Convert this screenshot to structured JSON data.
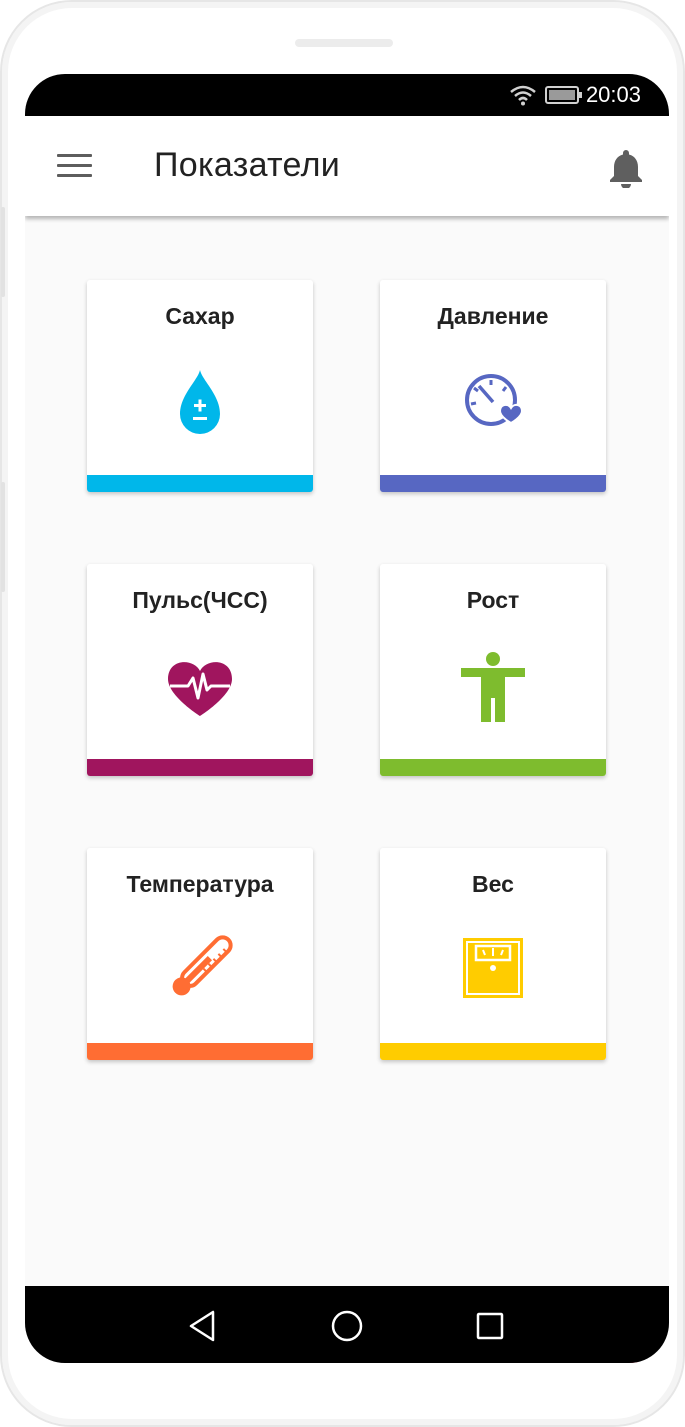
{
  "status_bar": {
    "time": "20:03"
  },
  "app_bar": {
    "title": "Показатели"
  },
  "colors": {
    "sugar": "#00b7ea",
    "pressure": "#5767c2",
    "pulse": "#a0155e",
    "height": "#7ebc2e",
    "temperature": "#ff6d33",
    "weight": "#ffcc00",
    "fab": "#ff3358"
  },
  "cards": [
    {
      "title": "Сахар",
      "icon": "drop-icon",
      "color": "#00b7ea"
    },
    {
      "title": "Давление",
      "icon": "pressure-gauge-heart-icon",
      "color": "#5767c2"
    },
    {
      "title": "Пульс(ЧСС)",
      "icon": "heart-pulse-icon",
      "color": "#a0155e"
    },
    {
      "title": "Рост",
      "icon": "person-icon",
      "color": "#7ebc2e"
    },
    {
      "title": "Температура",
      "icon": "thermometer-icon",
      "color": "#ff6d33"
    },
    {
      "title": "Вес",
      "icon": "scale-icon",
      "color": "#ffcc00"
    }
  ],
  "fab": {
    "icon": "pencil-icon"
  },
  "nav_bar": {
    "buttons": [
      "back-icon",
      "home-icon",
      "recents-icon"
    ]
  }
}
